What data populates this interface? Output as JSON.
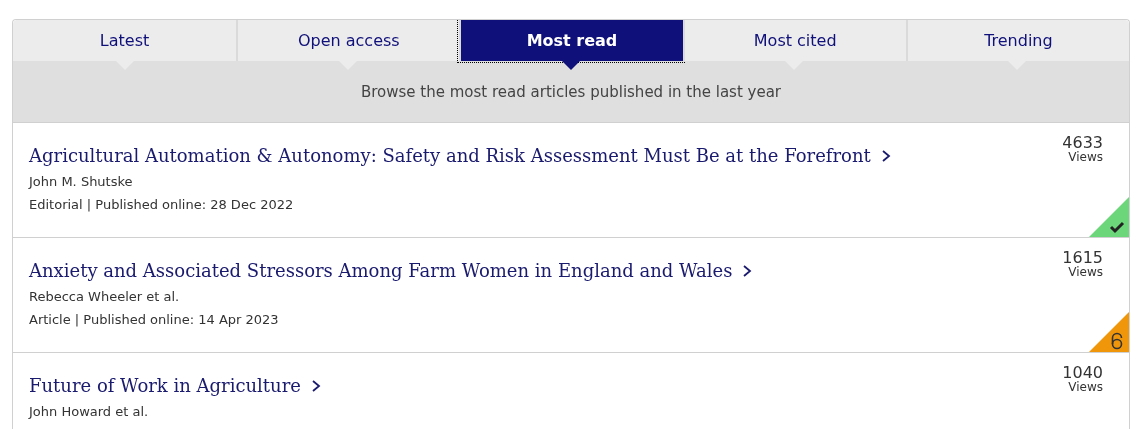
{
  "tabs": [
    {
      "label": "Latest",
      "selected": false
    },
    {
      "label": "Open access",
      "selected": false
    },
    {
      "label": "Most read",
      "selected": true
    },
    {
      "label": "Most cited",
      "selected": false
    },
    {
      "label": "Trending",
      "selected": false
    }
  ],
  "banner": "Browse the most read articles published in the last year",
  "articles": [
    {
      "title": "Agricultural Automation & Autonomy: Safety and Risk Assessment Must Be at the Forefront",
      "authors": "John M. Shutske",
      "meta": "Editorial | Published online: 28 Dec 2022",
      "views": "4633",
      "views_label": "Views",
      "kind": "free-access"
    },
    {
      "title": "Anxiety and Associated Stressors Among Farm Women in England and Wales",
      "authors": "Rebecca Wheeler et al.",
      "meta": "Article | Published online: 14 Apr 2023",
      "views": "1615",
      "views_label": "Views",
      "kind": "open-access"
    },
    {
      "title": "Future of Work in Agriculture",
      "authors": "John Howard et al.",
      "views": "1040",
      "views_label": "Views"
    }
  ]
}
